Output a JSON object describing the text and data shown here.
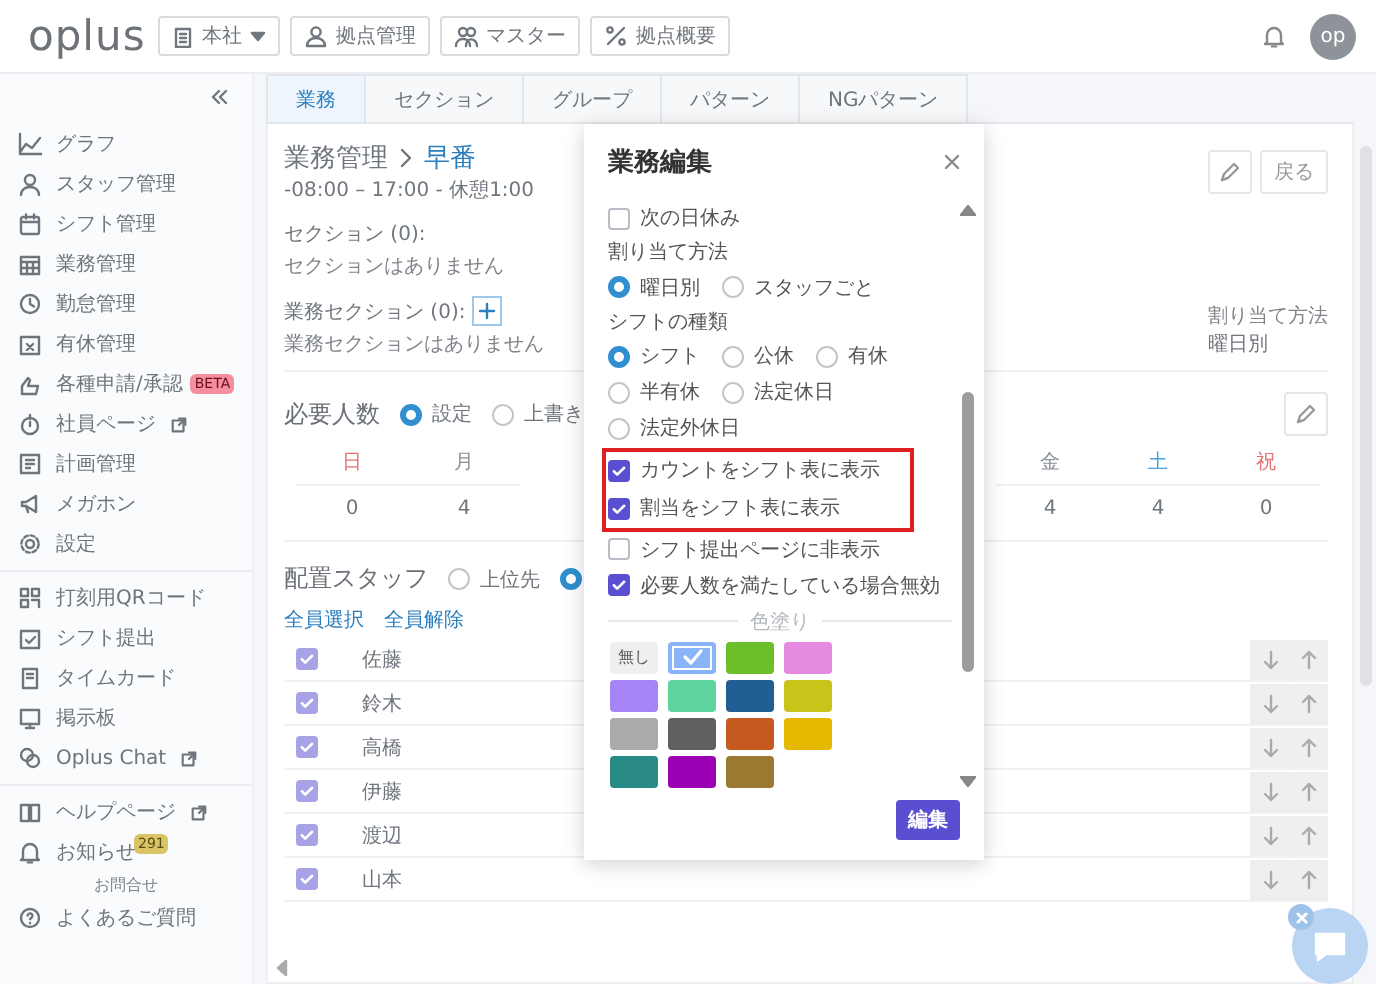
{
  "header": {
    "logo": "oplus",
    "branch": "本社",
    "buttons": [
      "拠点管理",
      "マスター",
      "拠点概要"
    ],
    "avatar": "op"
  },
  "sidebar": {
    "groups": [
      {
        "items": [
          {
            "label": "グラフ",
            "external": false
          },
          {
            "label": "スタッフ管理",
            "external": false
          },
          {
            "label": "シフト管理",
            "external": false
          },
          {
            "label": "業務管理",
            "external": false
          },
          {
            "label": "勤怠管理",
            "external": false
          },
          {
            "label": "有休管理",
            "external": false
          },
          {
            "label": "各種申請/承認",
            "external": false,
            "badge": {
              "text": "BETA",
              "color": "#f58fa0"
            }
          },
          {
            "label": "社員ページ",
            "external": true
          },
          {
            "label": "計画管理",
            "external": false
          },
          {
            "label": "メガホン",
            "external": false
          },
          {
            "label": "設定",
            "external": false
          }
        ]
      },
      {
        "items": [
          {
            "label": "打刻用QRコード",
            "external": false
          },
          {
            "label": "シフト提出",
            "external": false
          },
          {
            "label": "タイムカード",
            "external": false
          },
          {
            "label": "掲示板",
            "external": false
          },
          {
            "label": "Oplus Chat",
            "external": true
          }
        ]
      },
      {
        "items": [
          {
            "label": "ヘルプページ",
            "external": true
          },
          {
            "label": "お知らせ",
            "external": false,
            "badge": {
              "text": "291",
              "color": "#d9c466"
            }
          }
        ]
      }
    ],
    "contact": {
      "label": "お問合せ",
      "items": [
        {
          "label": "よくあるご質問",
          "external": false
        }
      ]
    }
  },
  "tabs": [
    {
      "label": "業務",
      "selected": true
    },
    {
      "label": "セクション",
      "selected": false
    },
    {
      "label": "グループ",
      "selected": false
    },
    {
      "label": "パターン",
      "selected": false
    },
    {
      "label": "NGパターン",
      "selected": false
    }
  ],
  "task": {
    "breadcrumb_parent": "業務管理",
    "breadcrumb_current": "早番",
    "hours": "-08:00 – 17:00 - 休憩1:00",
    "sections_label": "セクション (0):",
    "sections_empty": "セクションはありません",
    "task_sections_label": "業務セクション (0):",
    "task_sections_empty": "業務セクションはありません",
    "back_button": "戻る",
    "assign_label": "割り当て方法",
    "assign_value": "曜日別"
  },
  "required": {
    "title": "必要人数",
    "modes": [
      {
        "label": "設定",
        "selected": true
      },
      {
        "label": "上書き",
        "selected": false
      }
    ],
    "days": [
      {
        "label": "日",
        "value": "0",
        "color": "#e57373"
      },
      {
        "label": "月",
        "value": "4",
        "color": "#8a8f96"
      },
      {
        "label": "金",
        "value": "4",
        "color": "#8a8f96"
      },
      {
        "label": "土",
        "value": "4",
        "color": "#4aa3df"
      },
      {
        "label": "祝",
        "value": "0",
        "color": "#e57373"
      }
    ]
  },
  "staff": {
    "title": "配置スタッフ",
    "modes": [
      {
        "label": "上位先",
        "selected": false
      },
      {
        "selected": true
      }
    ],
    "select_all": "全員選択",
    "deselect_all": "全員解除",
    "rows": [
      {
        "name": "佐藤",
        "checked": true
      },
      {
        "name": "鈴木",
        "checked": true
      },
      {
        "name": "高橋",
        "checked": true
      },
      {
        "name": "伊藤",
        "checked": true
      },
      {
        "name": "渡辺",
        "checked": true
      },
      {
        "name": "山本",
        "checked": true
      }
    ]
  },
  "modal": {
    "title": "業務編集",
    "next_day_off": {
      "label": "次の日休み",
      "checked": false
    },
    "assign": {
      "label": "割り当て方法",
      "options": [
        {
          "label": "曜日別",
          "selected": true
        },
        {
          "label": "スタッフごと",
          "selected": false
        }
      ]
    },
    "shift_type": {
      "label": "シフトの種類",
      "options": [
        {
          "label": "シフト",
          "selected": true
        },
        {
          "label": "公休",
          "selected": false
        },
        {
          "label": "有休",
          "selected": false
        },
        {
          "label": "半有休",
          "selected": false
        },
        {
          "label": "法定休日",
          "selected": false
        },
        {
          "label": "法定外休日",
          "selected": false
        }
      ]
    },
    "highlighted": [
      {
        "label": "カウントをシフト表に表示",
        "checked": true
      },
      {
        "label": "割当をシフト表に表示",
        "checked": true
      }
    ],
    "more": [
      {
        "label": "シフト提出ページに非表示",
        "checked": false
      },
      {
        "label": "必要人数を満たしている場合無効",
        "checked": true
      }
    ],
    "color_label": "色塗り",
    "colors": [
      {
        "kind": "none",
        "label": "無し",
        "selected": false
      },
      {
        "kind": "swatch",
        "color": "#8ab4f8",
        "selected": true
      },
      {
        "kind": "swatch",
        "color": "#6cbf2a",
        "selected": false
      },
      {
        "kind": "swatch",
        "color": "#e58ae0",
        "selected": false
      },
      {
        "kind": "swatch",
        "color": "#a585f5",
        "selected": false
      },
      {
        "kind": "swatch",
        "color": "#5dd39e",
        "selected": false
      },
      {
        "kind": "swatch",
        "color": "#1f5f94",
        "selected": false
      },
      {
        "kind": "swatch",
        "color": "#c9c41a",
        "selected": false
      },
      {
        "kind": "swatch",
        "color": "#aaaaaa",
        "selected": false
      },
      {
        "kind": "swatch",
        "color": "#606060",
        "selected": false
      },
      {
        "kind": "swatch",
        "color": "#c65a1e",
        "selected": false
      },
      {
        "kind": "swatch",
        "color": "#e6b800",
        "selected": false
      },
      {
        "kind": "swatch",
        "color": "#2a8a86",
        "selected": false
      },
      {
        "kind": "swatch",
        "color": "#9b00b5",
        "selected": false
      },
      {
        "kind": "swatch",
        "color": "#9a7a30",
        "selected": false
      }
    ],
    "submit": "編集"
  }
}
